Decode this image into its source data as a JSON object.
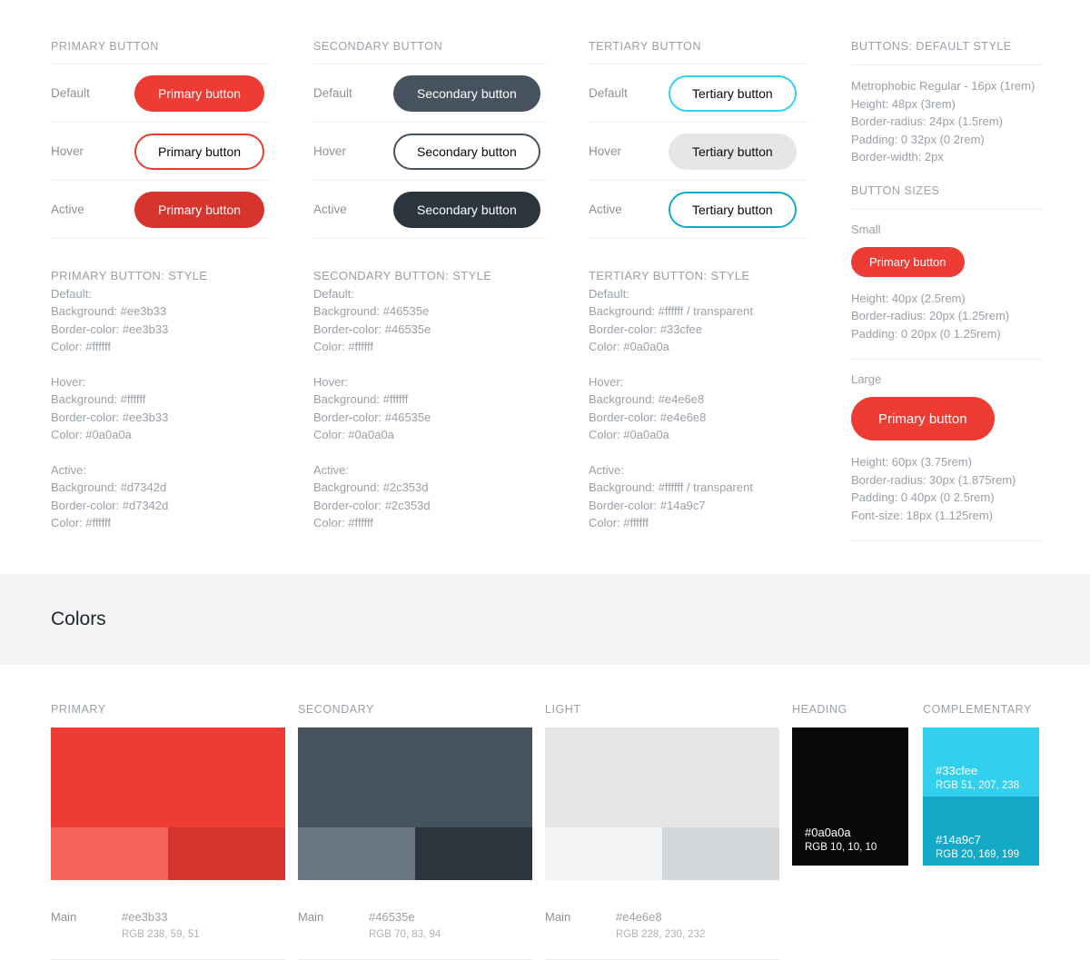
{
  "buttons": {
    "columns": [
      {
        "title": "PRIMARY BUTTON",
        "rows": [
          {
            "state": "Default",
            "label": "Primary button"
          },
          {
            "state": "Hover",
            "label": "Primary button"
          },
          {
            "state": "Active",
            "label": "Primary button"
          }
        ],
        "spec": {
          "title": "PRIMARY BUTTON: STYLE",
          "groups": [
            {
              "name": "Default:",
              "lines": [
                "Background: #ee3b33",
                "Border-color: #ee3b33",
                "Color: #ffffff"
              ]
            },
            {
              "name": "Hover:",
              "lines": [
                "Background: #ffffff",
                "Border-color: #ee3b33",
                "Color: #0a0a0a"
              ]
            },
            {
              "name": "Active:",
              "lines": [
                "Background: #d7342d",
                "Border-color: #d7342d",
                "Color: #ffffff"
              ]
            }
          ]
        }
      },
      {
        "title": "SECONDARY BUTTON",
        "rows": [
          {
            "state": "Default",
            "label": "Secondary button"
          },
          {
            "state": "Hover",
            "label": "Secondary button"
          },
          {
            "state": "Active",
            "label": "Secondary button"
          }
        ],
        "spec": {
          "title": "SECONDARY BUTTON: STYLE",
          "groups": [
            {
              "name": "Default:",
              "lines": [
                "Background: #46535e",
                "Border-color: #46535e",
                "Color: #ffffff"
              ]
            },
            {
              "name": "Hover:",
              "lines": [
                "Background: #ffffff",
                "Border-color: #46535e",
                "Color: #0a0a0a"
              ]
            },
            {
              "name": "Active:",
              "lines": [
                "Background: #2c353d",
                "Border-color: #2c353d",
                "Color: #ffffff"
              ]
            }
          ]
        }
      },
      {
        "title": "TERTIARY BUTTON",
        "rows": [
          {
            "state": "Default",
            "label": "Tertiary button"
          },
          {
            "state": "Hover",
            "label": "Tertiary button"
          },
          {
            "state": "Active",
            "label": "Tertiary button"
          }
        ],
        "spec": {
          "title": "TERTIARY BUTTON: STYLE",
          "groups": [
            {
              "name": "Default:",
              "lines": [
                "Background: #ffffff / transparent",
                "Border-color: #33cfee",
                "Color: #0a0a0a"
              ]
            },
            {
              "name": "Hover:",
              "lines": [
                "Background: #e4e6e8",
                "Border-color: #e4e6e8",
                "Color: #0a0a0a"
              ]
            },
            {
              "name": "Active:",
              "lines": [
                "Background: #ffffff / transparent",
                "Border-color: #14a9c7",
                "Color: #ffffff"
              ]
            }
          ]
        }
      }
    ]
  },
  "sidebar": {
    "default_style": {
      "title": "BUTTONS: DEFAULT STYLE",
      "lines": [
        "Metrophobic Regular - 16px (1rem)",
        "Height: 48px (3rem)",
        "Border-radius: 24px (1.5rem)",
        "Padding: 0 32px (0 2rem)",
        "Border-width: 2px"
      ]
    },
    "sizes": {
      "title": "BUTTON SIZES",
      "small": {
        "name": "Small",
        "button_label": "Primary button",
        "lines": [
          "Height: 40px (2.5rem)",
          "Border-radius: 20px (1.25rem)",
          "Padding: 0 20px (0 1.25rem)"
        ]
      },
      "large": {
        "name": "Large",
        "button_label": "Primary button",
        "lines": [
          "Height: 60px (3.75rem)",
          "Border-radius: 30px (1.875rem)",
          "Padding: 0 40px (0 2.5rem)",
          "Font-size: 18px (1.125rem)"
        ]
      }
    }
  },
  "colors_section": {
    "heading": "Colors",
    "wide_swatches": [
      {
        "title": "PRIMARY",
        "main_color": "#ee3b33",
        "light_color": "#f4645d",
        "dark_color": "#d7342d",
        "meta_name": "Main",
        "meta_hex": "#ee3b33",
        "meta_rgb": "RGB 238, 59, 51"
      },
      {
        "title": "SECONDARY",
        "main_color": "#46535e",
        "light_color": "#6a7783",
        "dark_color": "#2c353d",
        "meta_name": "Main",
        "meta_hex": "#46535e",
        "meta_rgb": "RGB 70, 83, 94"
      },
      {
        "title": "LIGHT",
        "main_color": "#e4e6e8",
        "light_color": "#f4f5f6",
        "dark_color": "#d4d7da",
        "meta_name": "Main",
        "meta_hex": "#e4e6e8",
        "meta_rgb": "RGB 228, 230, 232"
      }
    ],
    "heading_swatch": {
      "title": "HEADING",
      "color": "#0a0a0a",
      "hex": "#0a0a0a",
      "rgb": "RGB 10, 10, 10"
    },
    "complementary_swatch": {
      "title": "COMPLEMENTARY",
      "top_color": "#33cfee",
      "top_hex": "#33cfee",
      "top_rgb": "RGB 51, 207, 238",
      "bottom_color": "#14a9c7",
      "bottom_hex": "#14a9c7",
      "bottom_rgb": "RGB 20, 169, 199"
    }
  }
}
